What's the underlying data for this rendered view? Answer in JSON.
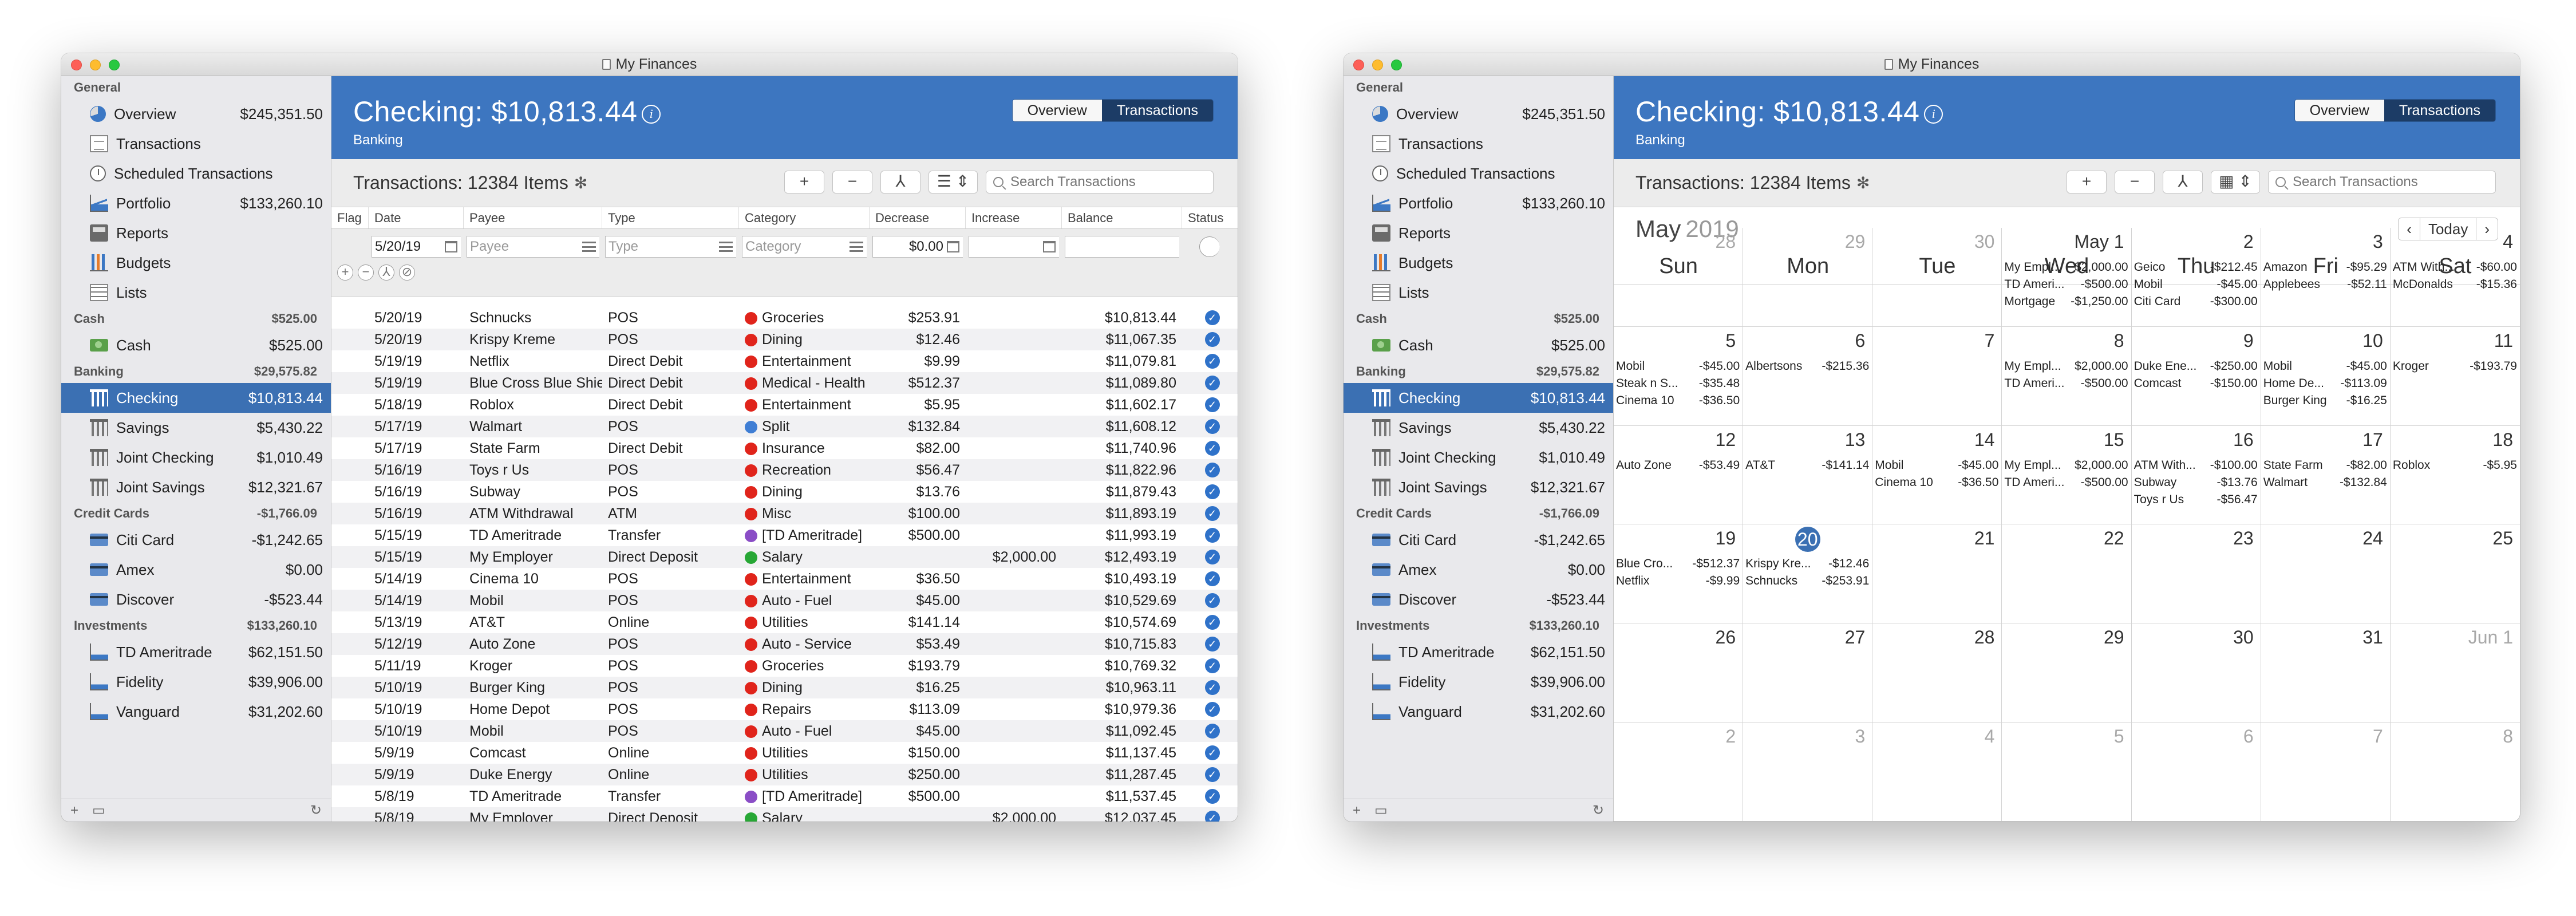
{
  "window_title": "My Finances",
  "account": {
    "title": "Checking: $10,813.44",
    "subtitle": "Banking"
  },
  "view_tabs": {
    "overview": "Overview",
    "transactions": "Transactions"
  },
  "toolbar": {
    "title": "Transactions: 12384 Items",
    "add": "+",
    "remove": "−",
    "split": "⅄",
    "search_placeholder": "Search Transactions"
  },
  "sidebar": {
    "general": {
      "header": "General",
      "items": [
        {
          "label": "Overview",
          "amount": "$245,351.50",
          "icon": "pie-chart-icon"
        },
        {
          "label": "Transactions",
          "amount": "",
          "icon": "document-icon"
        },
        {
          "label": "Scheduled Transactions",
          "amount": "",
          "icon": "clock-icon"
        },
        {
          "label": "Portfolio",
          "amount": "$133,260.10",
          "icon": "portfolio-chart-icon"
        },
        {
          "label": "Reports",
          "amount": "",
          "icon": "report-icon"
        },
        {
          "label": "Budgets",
          "amount": "",
          "icon": "budget-icon"
        },
        {
          "label": "Lists",
          "amount": "",
          "icon": "list-icon"
        }
      ]
    },
    "cash": {
      "header": "Cash",
      "total": "$525.00",
      "items": [
        {
          "label": "Cash",
          "amount": "$525.00",
          "icon": "cash-icon"
        }
      ]
    },
    "banking": {
      "header": "Banking",
      "total": "$29,575.82",
      "items": [
        {
          "label": "Checking",
          "amount": "$10,813.44",
          "icon": "bank-icon"
        },
        {
          "label": "Savings",
          "amount": "$5,430.22",
          "icon": "bank-icon"
        },
        {
          "label": "Joint Checking",
          "amount": "$1,010.49",
          "icon": "bank-icon"
        },
        {
          "label": "Joint Savings",
          "amount": "$12,321.67",
          "icon": "bank-icon"
        }
      ]
    },
    "credit": {
      "header": "Credit Cards",
      "total": "-$1,766.09",
      "items": [
        {
          "label": "Citi Card",
          "amount": "-$1,242.65",
          "icon": "credit-card-icon"
        },
        {
          "label": "Amex",
          "amount": "$0.00",
          "icon": "credit-card-icon"
        },
        {
          "label": "Discover",
          "amount": "-$523.44",
          "icon": "credit-card-icon"
        }
      ]
    },
    "investments": {
      "header": "Investments",
      "total": "$133,260.10",
      "items": [
        {
          "label": "TD Ameritrade",
          "amount": "$62,151.50",
          "icon": "investment-icon"
        },
        {
          "label": "Fidelity",
          "amount": "$39,906.00",
          "icon": "investment-icon"
        },
        {
          "label": "Vanguard",
          "amount": "$31,202.60",
          "icon": "investment-icon"
        }
      ]
    },
    "footer": {
      "add": "+",
      "reload": "↻"
    }
  },
  "table": {
    "columns": {
      "flag": "Flag",
      "date": "Date",
      "payee": "Payee",
      "type": "Type",
      "category": "Category",
      "decrease": "Decrease",
      "increase": "Increase",
      "balance": "Balance",
      "status": "Status"
    },
    "entry": {
      "date": "5/20/19",
      "payee_placeholder": "Payee",
      "type_placeholder": "Type",
      "category_placeholder": "Category",
      "decrease": "$0.00"
    },
    "rows": [
      {
        "date": "5/20/19",
        "payee": "Schnucks",
        "type": "POS",
        "category": "Groceries",
        "color": "#e0241b",
        "decrease": "$253.91",
        "increase": "",
        "balance": "$10,813.44"
      },
      {
        "date": "5/20/19",
        "payee": "Krispy Kreme",
        "type": "POS",
        "category": "Dining",
        "color": "#e0241b",
        "decrease": "$12.46",
        "increase": "",
        "balance": "$11,067.35"
      },
      {
        "date": "5/19/19",
        "payee": "Netflix",
        "type": "Direct Debit",
        "category": "Entertainment",
        "color": "#e0241b",
        "decrease": "$9.99",
        "increase": "",
        "balance": "$11,079.81"
      },
      {
        "date": "5/19/19",
        "payee": "Blue Cross Blue Shield",
        "type": "Direct Debit",
        "category": "Medical - Health",
        "color": "#e0241b",
        "decrease": "$512.37",
        "increase": "",
        "balance": "$11,089.80"
      },
      {
        "date": "5/18/19",
        "payee": "Roblox",
        "type": "Direct Debit",
        "category": "Entertainment",
        "color": "#e0241b",
        "decrease": "$5.95",
        "increase": "",
        "balance": "$11,602.17"
      },
      {
        "date": "5/17/19",
        "payee": "Walmart",
        "type": "POS",
        "category": "Split",
        "color": "#3f7ed4",
        "decrease": "$132.84",
        "increase": "",
        "balance": "$11,608.12"
      },
      {
        "date": "5/17/19",
        "payee": "State Farm",
        "type": "Direct Debit",
        "category": "Insurance",
        "color": "#e0241b",
        "decrease": "$82.00",
        "increase": "",
        "balance": "$11,740.96"
      },
      {
        "date": "5/16/19",
        "payee": "Toys r Us",
        "type": "POS",
        "category": "Recreation",
        "color": "#e0241b",
        "decrease": "$56.47",
        "increase": "",
        "balance": "$11,822.96"
      },
      {
        "date": "5/16/19",
        "payee": "Subway",
        "type": "POS",
        "category": "Dining",
        "color": "#e0241b",
        "decrease": "$13.76",
        "increase": "",
        "balance": "$11,879.43"
      },
      {
        "date": "5/16/19",
        "payee": "ATM Withdrawal",
        "type": "ATM",
        "category": "Misc",
        "color": "#e0241b",
        "decrease": "$100.00",
        "increase": "",
        "balance": "$11,893.19"
      },
      {
        "date": "5/15/19",
        "payee": "TD Ameritrade",
        "type": "Transfer",
        "category": "[TD Ameritrade]",
        "color": "#8a4dc6",
        "decrease": "$500.00",
        "increase": "",
        "balance": "$11,993.19"
      },
      {
        "date": "5/15/19",
        "payee": "My Employer",
        "type": "Direct Deposit",
        "category": "Salary",
        "color": "#27a735",
        "decrease": "",
        "increase": "$2,000.00",
        "balance": "$12,493.19"
      },
      {
        "date": "5/14/19",
        "payee": "Cinema 10",
        "type": "POS",
        "category": "Entertainment",
        "color": "#e0241b",
        "decrease": "$36.50",
        "increase": "",
        "balance": "$10,493.19"
      },
      {
        "date": "5/14/19",
        "payee": "Mobil",
        "type": "POS",
        "category": "Auto - Fuel",
        "color": "#e0241b",
        "decrease": "$45.00",
        "increase": "",
        "balance": "$10,529.69"
      },
      {
        "date": "5/13/19",
        "payee": "AT&T",
        "type": "Online",
        "category": "Utilities",
        "color": "#e0241b",
        "decrease": "$141.14",
        "increase": "",
        "balance": "$10,574.69"
      },
      {
        "date": "5/12/19",
        "payee": "Auto Zone",
        "type": "POS",
        "category": "Auto - Service",
        "color": "#e0241b",
        "decrease": "$53.49",
        "increase": "",
        "balance": "$10,715.83"
      },
      {
        "date": "5/11/19",
        "payee": "Kroger",
        "type": "POS",
        "category": "Groceries",
        "color": "#e0241b",
        "decrease": "$193.79",
        "increase": "",
        "balance": "$10,769.32"
      },
      {
        "date": "5/10/19",
        "payee": "Burger King",
        "type": "POS",
        "category": "Dining",
        "color": "#e0241b",
        "decrease": "$16.25",
        "increase": "",
        "balance": "$10,963.11"
      },
      {
        "date": "5/10/19",
        "payee": "Home Depot",
        "type": "POS",
        "category": "Repairs",
        "color": "#e0241b",
        "decrease": "$113.09",
        "increase": "",
        "balance": "$10,979.36"
      },
      {
        "date": "5/10/19",
        "payee": "Mobil",
        "type": "POS",
        "category": "Auto - Fuel",
        "color": "#e0241b",
        "decrease": "$45.00",
        "increase": "",
        "balance": "$11,092.45"
      },
      {
        "date": "5/9/19",
        "payee": "Comcast",
        "type": "Online",
        "category": "Utilities",
        "color": "#e0241b",
        "decrease": "$150.00",
        "increase": "",
        "balance": "$11,137.45"
      },
      {
        "date": "5/9/19",
        "payee": "Duke Energy",
        "type": "Online",
        "category": "Utilities",
        "color": "#e0241b",
        "decrease": "$250.00",
        "increase": "",
        "balance": "$11,287.45"
      },
      {
        "date": "5/8/19",
        "payee": "TD Ameritrade",
        "type": "Transfer",
        "category": "[TD Ameritrade]",
        "color": "#8a4dc6",
        "decrease": "$500.00",
        "increase": "",
        "balance": "$11,537.45"
      },
      {
        "date": "5/8/19",
        "payee": "My Employer",
        "type": "Direct Deposit",
        "category": "Salary",
        "color": "#27a735",
        "decrease": "",
        "increase": "$2,000.00",
        "balance": "$12,037.45"
      }
    ]
  },
  "calendar": {
    "month": "May",
    "year": "2019",
    "today_label": "Today",
    "prev": "‹",
    "next": "›",
    "weekdays": [
      "Sun",
      "Mon",
      "Tue",
      "Wed",
      "Thu",
      "Fri",
      "Sat"
    ],
    "days": [
      {
        "num": "28",
        "dim": true,
        "events": []
      },
      {
        "num": "29",
        "dim": true,
        "events": []
      },
      {
        "num": "30",
        "dim": true,
        "events": []
      },
      {
        "num": "May 1",
        "dim": false,
        "events": [
          [
            "My Empl...",
            "$2,000.00"
          ],
          [
            "TD Ameri...",
            "-$500.00"
          ],
          [
            "Mortgage",
            "-$1,250.00"
          ]
        ]
      },
      {
        "num": "2",
        "dim": false,
        "events": [
          [
            "Geico",
            "-$212.45"
          ],
          [
            "Mobil",
            "-$45.00"
          ],
          [
            "Citi Card",
            "-$300.00"
          ]
        ]
      },
      {
        "num": "3",
        "dim": false,
        "events": [
          [
            "Amazon",
            "-$95.29"
          ],
          [
            "Applebees",
            "-$52.11"
          ]
        ]
      },
      {
        "num": "4",
        "dim": false,
        "events": [
          [
            "ATM With...",
            "-$60.00"
          ],
          [
            "McDonalds",
            "-$15.36"
          ]
        ]
      },
      {
        "num": "5",
        "dim": false,
        "events": [
          [
            "Mobil",
            "-$45.00"
          ],
          [
            "Steak n S...",
            "-$35.48"
          ],
          [
            "Cinema 10",
            "-$36.50"
          ]
        ]
      },
      {
        "num": "6",
        "dim": false,
        "events": [
          [
            "Albertsons",
            "-$215.36"
          ]
        ]
      },
      {
        "num": "7",
        "dim": false,
        "events": []
      },
      {
        "num": "8",
        "dim": false,
        "events": [
          [
            "My Empl...",
            "$2,000.00"
          ],
          [
            "TD Ameri...",
            "-$500.00"
          ]
        ]
      },
      {
        "num": "9",
        "dim": false,
        "events": [
          [
            "Duke Ene...",
            "-$250.00"
          ],
          [
            "Comcast",
            "-$150.00"
          ]
        ]
      },
      {
        "num": "10",
        "dim": false,
        "events": [
          [
            "Mobil",
            "-$45.00"
          ],
          [
            "Home De...",
            "-$113.09"
          ],
          [
            "Burger King",
            "-$16.25"
          ]
        ]
      },
      {
        "num": "11",
        "dim": false,
        "events": [
          [
            "Kroger",
            "-$193.79"
          ]
        ]
      },
      {
        "num": "12",
        "dim": false,
        "events": [
          [
            "Auto Zone",
            "-$53.49"
          ]
        ]
      },
      {
        "num": "13",
        "dim": false,
        "events": [
          [
            "AT&T",
            "-$141.14"
          ]
        ]
      },
      {
        "num": "14",
        "dim": false,
        "events": [
          [
            "Mobil",
            "-$45.00"
          ],
          [
            "Cinema 10",
            "-$36.50"
          ]
        ]
      },
      {
        "num": "15",
        "dim": false,
        "events": [
          [
            "My Empl...",
            "$2,000.00"
          ],
          [
            "TD Ameri...",
            "-$500.00"
          ]
        ]
      },
      {
        "num": "16",
        "dim": false,
        "events": [
          [
            "ATM With...",
            "-$100.00"
          ],
          [
            "Subway",
            "-$13.76"
          ],
          [
            "Toys r Us",
            "-$56.47"
          ]
        ]
      },
      {
        "num": "17",
        "dim": false,
        "events": [
          [
            "State Farm",
            "-$82.00"
          ],
          [
            "Walmart",
            "-$132.84"
          ]
        ]
      },
      {
        "num": "18",
        "dim": false,
        "events": [
          [
            "Roblox",
            "-$5.95"
          ]
        ]
      },
      {
        "num": "19",
        "dim": false,
        "events": [
          [
            "Blue Cro...",
            "-$512.37"
          ],
          [
            "Netflix",
            "-$9.99"
          ]
        ]
      },
      {
        "num": "20",
        "dim": false,
        "today": true,
        "events": [
          [
            "Krispy Kre...",
            "-$12.46"
          ],
          [
            "Schnucks",
            "-$253.91"
          ]
        ]
      },
      {
        "num": "21",
        "dim": false,
        "events": []
      },
      {
        "num": "22",
        "dim": false,
        "events": []
      },
      {
        "num": "23",
        "dim": false,
        "events": []
      },
      {
        "num": "24",
        "dim": false,
        "events": []
      },
      {
        "num": "25",
        "dim": false,
        "events": []
      },
      {
        "num": "26",
        "dim": false,
        "events": []
      },
      {
        "num": "27",
        "dim": false,
        "events": []
      },
      {
        "num": "28",
        "dim": false,
        "events": []
      },
      {
        "num": "29",
        "dim": false,
        "events": []
      },
      {
        "num": "30",
        "dim": false,
        "events": []
      },
      {
        "num": "31",
        "dim": false,
        "events": []
      },
      {
        "num": "Jun 1",
        "dim": true,
        "events": []
      },
      {
        "num": "2",
        "dim": true,
        "events": []
      },
      {
        "num": "3",
        "dim": true,
        "events": []
      },
      {
        "num": "4",
        "dim": true,
        "events": []
      },
      {
        "num": "5",
        "dim": true,
        "events": []
      },
      {
        "num": "6",
        "dim": true,
        "events": []
      },
      {
        "num": "7",
        "dim": true,
        "events": []
      },
      {
        "num": "8",
        "dim": true,
        "events": []
      }
    ]
  }
}
